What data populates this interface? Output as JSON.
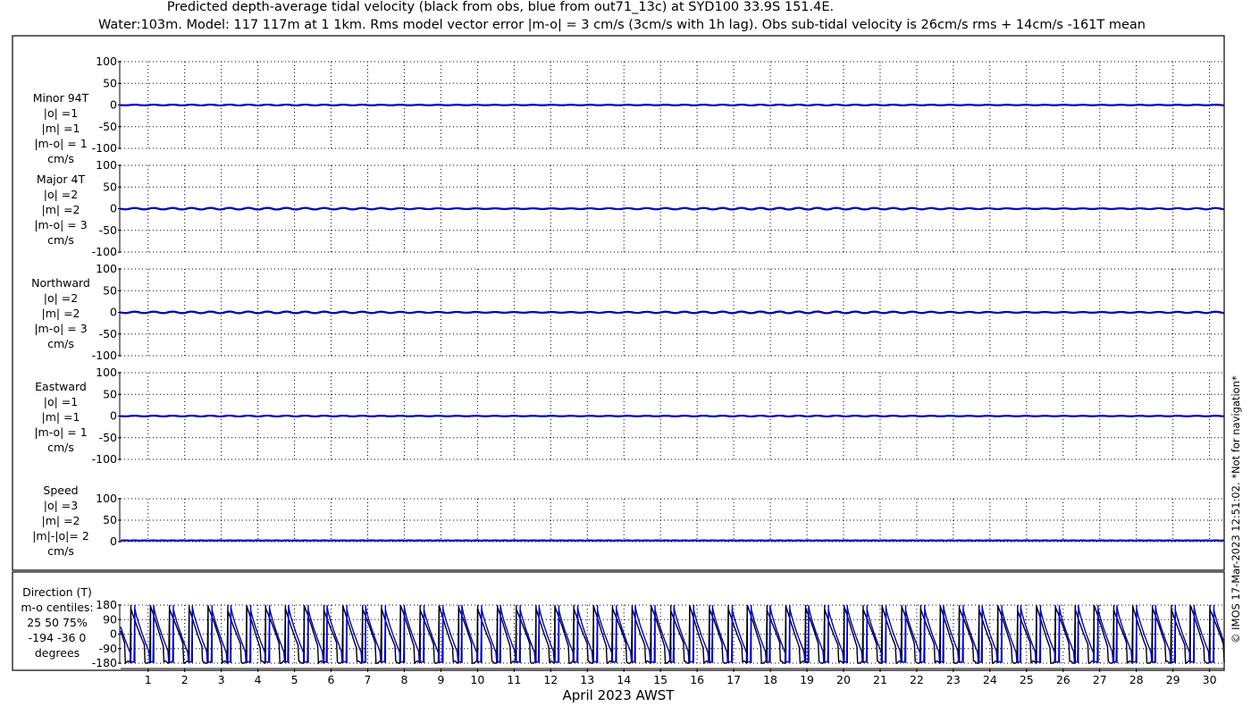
{
  "figure": {
    "title_line1": "Predicted depth-average tidal velocity (black from obs, blue from out71_13c) at SYD100 33.9S 151.4E.",
    "title_line2": "Water:103m. Model: 117 117m at 1 1km. Rms model vector error |m-o| = 3 cm/s (3cm/s with 1h lag). Obs sub-tidal velocity is 26cm/s rms + 14cm/s -161T mean",
    "xlabel": "April 2023 AWST",
    "credit": "© IMOS 17-Mar-2023 12:51:02. *Not for navigation*",
    "colors": {
      "obs": "#000000",
      "model": "#0000cc",
      "grid": "#000000",
      "background": "#ffffff"
    }
  },
  "chart_data": [
    {
      "type": "line",
      "panel": "minor",
      "label_lines": [
        "Minor 94T",
        "|o| =1",
        "|m| =1",
        "|m-o| = 1",
        "cm/s"
      ],
      "ylim": [
        -100,
        100
      ],
      "yticks": [
        "100",
        "50",
        "0",
        "-50",
        "-100"
      ],
      "xlim": [
        0.25,
        30.4
      ],
      "xticks": [
        "1",
        "2",
        "3",
        "4",
        "5",
        "6",
        "7",
        "8",
        "9",
        "10",
        "11",
        "12",
        "13",
        "14",
        "15",
        "16",
        "17",
        "18",
        "19",
        "20",
        "21",
        "22",
        "23",
        "24",
        "25",
        "26",
        "27",
        "28",
        "29",
        "30"
      ],
      "series": [
        {
          "role": "obs",
          "mean": 0,
          "amplitude": 1,
          "kind": "oscillation"
        },
        {
          "role": "model",
          "mean": 0,
          "amplitude": 1,
          "kind": "oscillation"
        }
      ]
    },
    {
      "type": "line",
      "panel": "major",
      "label_lines": [
        "Major 4T",
        "|o| =2",
        "|m| =2",
        "|m-o| = 3",
        "cm/s"
      ],
      "ylim": [
        -100,
        100
      ],
      "yticks": [
        "100",
        "50",
        "0",
        "-50",
        "-100"
      ],
      "xlim": [
        0.25,
        30.4
      ],
      "series": [
        {
          "role": "obs",
          "mean": 0,
          "amplitude": 2,
          "kind": "oscillation"
        },
        {
          "role": "model",
          "mean": 0,
          "amplitude": 2,
          "kind": "oscillation"
        }
      ]
    },
    {
      "type": "line",
      "panel": "northward",
      "label_lines": [
        "Northward",
        "|o| =2",
        "|m| =2",
        "|m-o| = 3",
        "cm/s"
      ],
      "ylim": [
        -100,
        100
      ],
      "yticks": [
        "100",
        "50",
        "0",
        "-50",
        "-100"
      ],
      "xlim": [
        0.25,
        30.4
      ],
      "series": [
        {
          "role": "obs",
          "mean": 0,
          "amplitude": 2,
          "kind": "oscillation"
        },
        {
          "role": "model",
          "mean": 0,
          "amplitude": 2,
          "kind": "oscillation"
        }
      ]
    },
    {
      "type": "line",
      "panel": "eastward",
      "label_lines": [
        "Eastward",
        "|o| =1",
        "|m| =1",
        "|m-o| = 1",
        "cm/s"
      ],
      "ylim": [
        -100,
        100
      ],
      "yticks": [
        "100",
        "50",
        "0",
        "-50",
        "-100"
      ],
      "xlim": [
        0.25,
        30.4
      ],
      "series": [
        {
          "role": "obs",
          "mean": 0,
          "amplitude": 1,
          "kind": "oscillation"
        },
        {
          "role": "model",
          "mean": 0,
          "amplitude": 1,
          "kind": "oscillation"
        }
      ]
    },
    {
      "type": "line",
      "panel": "speed",
      "label_lines": [
        "Speed",
        "|o| =3",
        "|m| =2",
        "|m|-|o|= 2",
        "cm/s"
      ],
      "ylim": [
        0,
        100
      ],
      "yticks": [
        "100",
        "50",
        "0"
      ],
      "xlim": [
        0.25,
        30.4
      ],
      "series": [
        {
          "role": "obs",
          "mean": 2,
          "amplitude": 1,
          "kind": "speed"
        },
        {
          "role": "model",
          "mean": 2,
          "amplitude": 1,
          "kind": "speed"
        }
      ]
    },
    {
      "type": "line",
      "panel": "direction",
      "label_lines": [
        "Direction (T)",
        "m-o centiles:",
        "25  50  75%",
        "-194  -36    0",
        "degrees"
      ],
      "ylim": [
        -180,
        180
      ],
      "yticks": [
        "180",
        "90",
        "0",
        "-90",
        "-180"
      ],
      "xlim": [
        0.25,
        30.4
      ],
      "series": [
        {
          "role": "obs",
          "kind": "direction",
          "cycles_per_day": 1.9,
          "phase_days": 0.0
        },
        {
          "role": "model",
          "kind": "direction",
          "cycles_per_day": 1.9,
          "phase_days": 0.1
        }
      ]
    }
  ]
}
